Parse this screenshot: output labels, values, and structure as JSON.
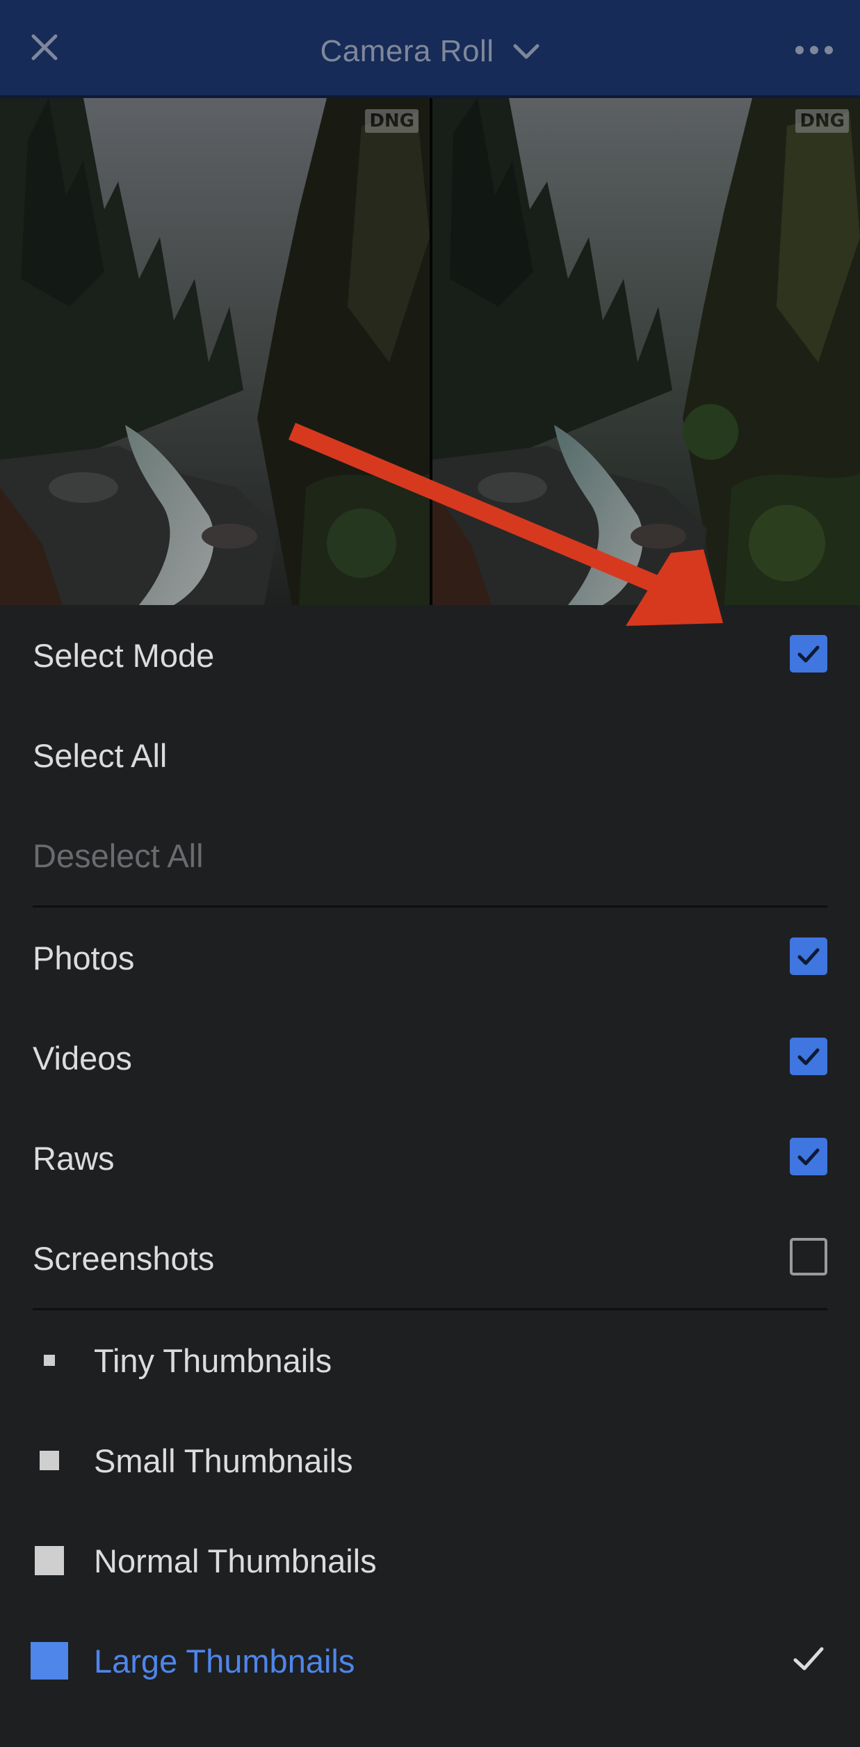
{
  "header": {
    "title": "Camera Roll",
    "close_icon": "close-icon",
    "dropdown_icon": "chevron-down-icon",
    "more_icon": "more-horizontal-icon"
  },
  "photos": [
    {
      "badge": "DNG"
    },
    {
      "badge": "DNG"
    }
  ],
  "menu": {
    "select_mode": {
      "label": "Select Mode",
      "checked": true
    },
    "select_all": {
      "label": "Select All"
    },
    "deselect_all": {
      "label": "Deselect All",
      "enabled": false
    },
    "filters": [
      {
        "label": "Photos",
        "checked": true
      },
      {
        "label": "Videos",
        "checked": true
      },
      {
        "label": "Raws",
        "checked": true
      },
      {
        "label": "Screenshots",
        "checked": false
      }
    ],
    "thumbnail_sizes": [
      {
        "label": "Tiny Thumbnails",
        "selected": false
      },
      {
        "label": "Small Thumbnails",
        "selected": false
      },
      {
        "label": "Normal Thumbnails",
        "selected": false
      },
      {
        "label": "Large Thumbnails",
        "selected": true
      }
    ]
  },
  "colors": {
    "header_bg": "#162b57",
    "accent": "#4e86ea",
    "checkbox_fill": "#3f76e0",
    "menu_bg": "#1e1f21",
    "annotation_arrow": "#d7391f"
  }
}
